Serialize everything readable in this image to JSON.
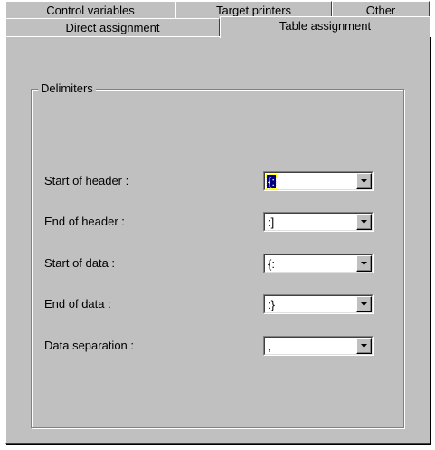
{
  "tabs_back": [
    "Control variables",
    "Target printers",
    "Other"
  ],
  "tabs_front": [
    "Direct assignment",
    "Table assignment"
  ],
  "group_title": "Delimiters",
  "fields": [
    {
      "label": "Start of header :",
      "value": "{:"
    },
    {
      "label": "End of header :",
      "value": ":]"
    },
    {
      "label": "Start of data :",
      "value": "{:"
    },
    {
      "label": "End of data :",
      "value": ":}"
    },
    {
      "label": "Data separation :",
      "value": ","
    }
  ]
}
